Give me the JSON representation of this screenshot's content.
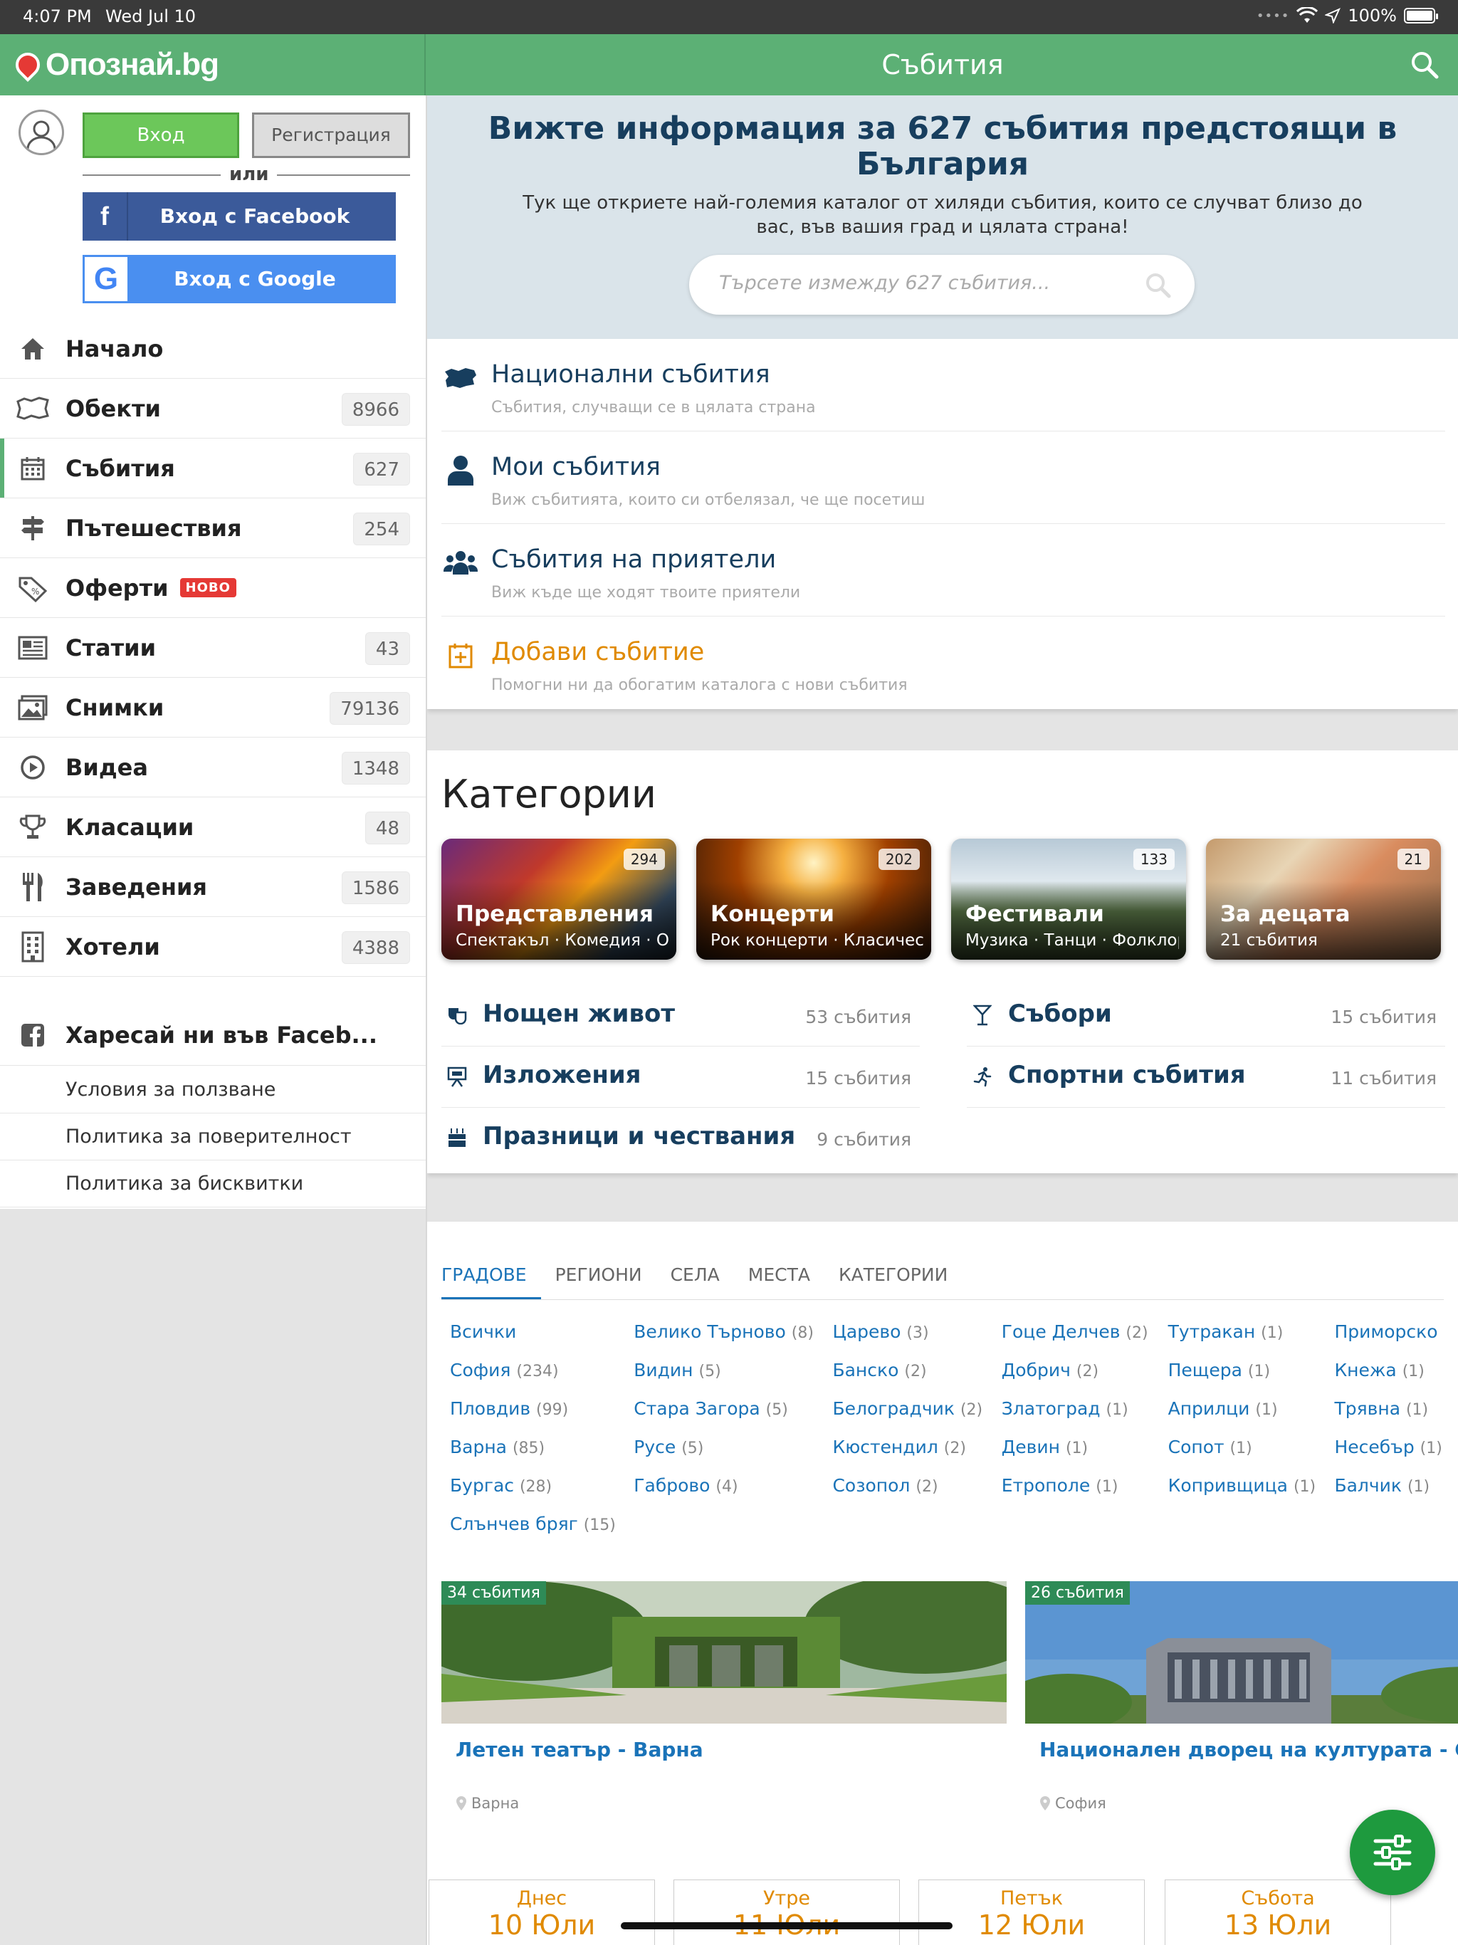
{
  "status_bar": {
    "time": "4:07 PM",
    "date": "Wed Jul 10",
    "battery": "100%"
  },
  "header": {
    "logo": "Опознай.bg",
    "title": "Събития"
  },
  "auth": {
    "login_label": "Вход",
    "register_label": "Регистрация",
    "or_label": "или",
    "facebook_label": "Вход с Facebook",
    "google_label": "Вход с Google"
  },
  "sidebar": {
    "items": [
      {
        "label": "Начало",
        "count": null,
        "icon": "home-icon"
      },
      {
        "label": "Обекти",
        "count": "8966",
        "icon": "map-icon"
      },
      {
        "label": "Събития",
        "count": "627",
        "icon": "calendar-icon"
      },
      {
        "label": "Пътешествия",
        "count": "254",
        "icon": "signpost-icon"
      },
      {
        "label": "Оферти",
        "count": null,
        "badge": "НОВО",
        "icon": "tag-icon"
      },
      {
        "label": "Статии",
        "count": "43",
        "icon": "newspaper-icon"
      },
      {
        "label": "Снимки",
        "count": "79136",
        "icon": "image-icon"
      },
      {
        "label": "Видеа",
        "count": "1348",
        "icon": "play-icon"
      },
      {
        "label": "Класации",
        "count": "48",
        "icon": "trophy-icon"
      },
      {
        "label": "Заведения",
        "count": "1586",
        "icon": "cutlery-icon"
      },
      {
        "label": "Хотели",
        "count": "4388",
        "icon": "building-icon"
      }
    ],
    "facebook_like": "Харесай ни във Faceb...",
    "links": [
      "Условия за ползване",
      "Политика за поверителност",
      "Политика за бисквитки"
    ]
  },
  "hero": {
    "title": "Вижте информация за 627 събития предстоящи в България",
    "subtitle": "Тук ще откриете най-големия каталог от хиляди събития, които се случват близо до вас, във вашия град и цялата страна!",
    "search_placeholder": "Търсете измежду 627 събития..."
  },
  "event_lists": [
    {
      "title": "Национални събития",
      "subtitle": "Събития, случващи се в цялата страна",
      "icon": "bulgaria-map-icon"
    },
    {
      "title": "Мои събития",
      "subtitle": "Виж събитията, които си отбелязал, че ще посетиш",
      "icon": "user-icon"
    },
    {
      "title": "Събития на приятели",
      "subtitle": "Виж къде ще ходят твоите приятели",
      "icon": "users-icon"
    },
    {
      "title": "Добави събитие",
      "subtitle": "Помогни ни да обогатим каталога с нови събития",
      "icon": "calendar-plus-icon"
    }
  ],
  "categories": {
    "heading": "Категории",
    "cards": [
      {
        "title": "Представления",
        "subtitle": "Спектакъл · Комедия · Опера",
        "count": "294"
      },
      {
        "title": "Концерти",
        "subtitle": "Рок концерти · Класическа музика",
        "count": "202"
      },
      {
        "title": "Фестивали",
        "subtitle": "Музика · Танци · Фолклор",
        "count": "133"
      },
      {
        "title": "За децата",
        "subtitle": "21 събития",
        "count": "21"
      }
    ],
    "links": [
      {
        "title": "Нощен живот",
        "count": "53 събития",
        "icon": "mask-icon"
      },
      {
        "title": "Събори",
        "count": "15 събития",
        "icon": "cocktail-icon"
      },
      {
        "title": "Изложения",
        "count": "15 събития",
        "icon": "easel-icon"
      },
      {
        "title": "Спортни събития",
        "count": "11 събития",
        "icon": "runner-icon"
      },
      {
        "title": "Празници и чествания",
        "count": "9 събития",
        "icon": "cake-icon"
      }
    ]
  },
  "locations": {
    "tabs": [
      "ГРАДОВЕ",
      "РЕГИОНИ",
      "СЕЛА",
      "МЕСТА",
      "КАТЕГОРИИ"
    ],
    "columns": [
      [
        {
          "name": "Всички",
          "count": ""
        },
        {
          "name": "София",
          "count": "(234)"
        },
        {
          "name": "Пловдив",
          "count": "(99)"
        },
        {
          "name": "Варна",
          "count": "(85)"
        },
        {
          "name": "Бургас",
          "count": "(28)"
        },
        {
          "name": "Слънчев бряг",
          "count": "(15)"
        }
      ],
      [
        {
          "name": "Велико Търново",
          "count": "(8)"
        },
        {
          "name": "Видин",
          "count": "(5)"
        },
        {
          "name": "Стара Загора",
          "count": "(5)"
        },
        {
          "name": "Русе",
          "count": "(5)"
        },
        {
          "name": "Габрово",
          "count": "(4)"
        }
      ],
      [
        {
          "name": "Царево",
          "count": "(3)"
        },
        {
          "name": "Банско",
          "count": "(2)"
        },
        {
          "name": "Белоградчик",
          "count": "(2)"
        },
        {
          "name": "Кюстендил",
          "count": "(2)"
        },
        {
          "name": "Созопол",
          "count": "(2)"
        }
      ],
      [
        {
          "name": "Гоце Делчев",
          "count": "(2)"
        },
        {
          "name": "Добрич",
          "count": "(2)"
        },
        {
          "name": "Златоград",
          "count": "(1)"
        },
        {
          "name": "Девин",
          "count": "(1)"
        },
        {
          "name": "Етрополе",
          "count": "(1)"
        }
      ],
      [
        {
          "name": "Тутракан",
          "count": "(1)"
        },
        {
          "name": "Пещера",
          "count": "(1)"
        },
        {
          "name": "Априлци",
          "count": "(1)"
        },
        {
          "name": "Сопот",
          "count": "(1)"
        },
        {
          "name": "Копривщица",
          "count": "(1)"
        }
      ],
      [
        {
          "name": "Приморско",
          "count": ""
        },
        {
          "name": "Кнежа",
          "count": "(1)"
        },
        {
          "name": "Трявна",
          "count": "(1)"
        },
        {
          "name": "Несебър",
          "count": "(1)"
        },
        {
          "name": "Балчик",
          "count": "(1)"
        }
      ]
    ]
  },
  "venues": [
    {
      "badge": "34 събития",
      "title": "Летен театър - Варна",
      "location": "Варна"
    },
    {
      "badge": "26 събития",
      "title": "Национален дворец на културата - София",
      "location": "София"
    }
  ],
  "days": [
    {
      "day": "Днес",
      "date": "10 Юли"
    },
    {
      "day": "Утре",
      "date": "11 Юли"
    },
    {
      "day": "Петък",
      "date": "12 Юли"
    },
    {
      "day": "Събота",
      "date": "13 Юли"
    }
  ],
  "colors": {
    "brand_green": "#5cb075",
    "title_blue": "#173e5e",
    "link_blue": "#1a73b8",
    "accent_orange": "#e08a00",
    "badge_red": "#e53935"
  }
}
